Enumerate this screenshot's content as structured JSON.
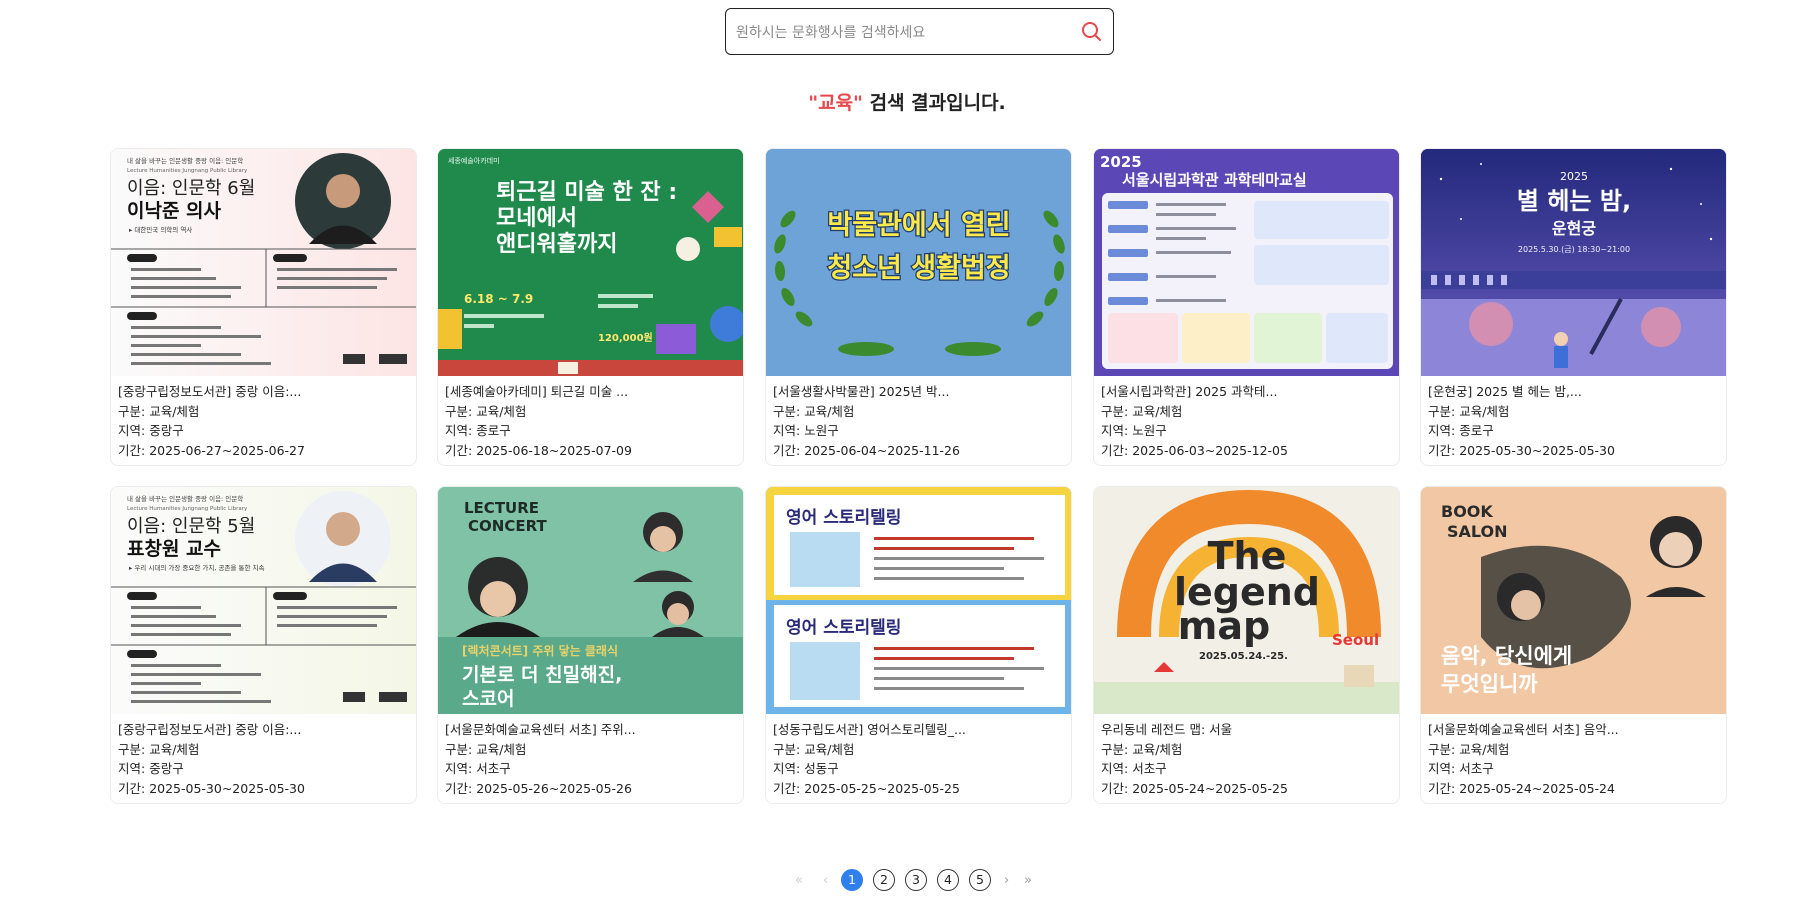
{
  "search": {
    "placeholder": "원하시는 문화행사를 검색하세요"
  },
  "result": {
    "keyword": "\"교육\"",
    "suffix": " 검색 결과입니다."
  },
  "labels": {
    "category": "구분: ",
    "region": "지역: ",
    "period": "기간: "
  },
  "cards": [
    {
      "title": "[중랑구립정보도서관] 중랑 이음:...",
      "category": "교육/체험",
      "region": "중랑구",
      "period": "2025-06-27~2025-06-27",
      "poster": {
        "top": "내 삶을 바꾸는 인문생활  중랑 이음: 인문학",
        "sub": "Lecture Humanities  Jungnang Public Library",
        "headline": "이음: 인문학 6월",
        "name": "이낙준 의사",
        "desc": "▸ 대한민국 의학의 역사"
      }
    },
    {
      "title": "[세종예술아카데미] 퇴근길 미술 ...",
      "category": "교육/체험",
      "region": "종로구",
      "period": "2025-06-18~2025-07-09",
      "poster": {
        "tag": "세종예술아카데미",
        "line1": "퇴근길 미술 한 잔 :",
        "line2": "모네에서",
        "line3": "앤디워홀까지",
        "date": "6.18 ~ 7.9",
        "fee": "120,000원"
      }
    },
    {
      "title": "[서울생활사박물관] 2025년 박...",
      "category": "교육/체험",
      "region": "노원구",
      "period": "2025-06-04~2025-11-26",
      "poster": {
        "line1": "박물관에서 열린",
        "line2": "청소년 생활법정"
      }
    },
    {
      "title": "[서울시립과학관] 2025 과학테...",
      "category": "교육/체험",
      "region": "노원구",
      "period": "2025-06-03~2025-12-05",
      "poster": {
        "year": "2025",
        "line1": "서울시립과학관 과학테마교실"
      }
    },
    {
      "title": "[운현궁] 2025 별 헤는 밤,...",
      "category": "교육/체험",
      "region": "종로구",
      "period": "2025-05-30~2025-05-30",
      "poster": {
        "year": "2025",
        "line1": "별 헤는 밤,",
        "line2": "운현궁",
        "date": "2025.5.30.(금) 18:30~21:00"
      }
    },
    {
      "title": "[중랑구립정보도서관] 중랑 이음:...",
      "category": "교육/체험",
      "region": "중랑구",
      "period": "2025-05-30~2025-05-30",
      "poster": {
        "top": "내 삶을 바꾸는 인문생활  중랑 이음: 인문학",
        "sub": "Lecture Humanities  Jungnang Public Library",
        "headline": "이음: 인문학 5월",
        "name": "표창원 교수",
        "desc": "▸ 우리 시대의 가장 중요한 가치, 공존을 통한 치속"
      }
    },
    {
      "title": "[서울문화예술교육센터 서초] 주위...",
      "category": "교육/체험",
      "region": "서초구",
      "period": "2025-05-26~2025-05-26",
      "poster": {
        "tag1": "LECTURE",
        "tag2": "CONCERT",
        "line1": "[렉처콘서트] 주위 닿는 클래식",
        "line2": "기본로 더 친밀해진,",
        "line3": "스코어"
      }
    },
    {
      "title": "[성동구립도서관] 영어스토리텔링_...",
      "category": "교육/체험",
      "region": "성동구",
      "period": "2025-05-25~2025-05-25",
      "poster": {
        "line1": "영어 스토리텔링",
        "line2": "영어 스토리텔링"
      }
    },
    {
      "title": "우리동네 레전드 맵: 서울",
      "category": "교육/체험",
      "region": "서초구",
      "period": "2025-05-24~2025-05-25",
      "poster": {
        "line1": "The",
        "line2": "legend",
        "line3": "map",
        "city": "Seoul",
        "date": "2025.05.24.-25."
      }
    },
    {
      "title": "[서울문화예술교육센터 서초] 음악...",
      "category": "교육/체험",
      "region": "서초구",
      "period": "2025-05-24~2025-05-24",
      "poster": {
        "tag1": "BOOK",
        "tag2": "SALON",
        "line1": "음악, 당신에게",
        "line2": "무엇입니까"
      }
    }
  ],
  "pagination": {
    "first": "«",
    "prev": "‹",
    "next": "›",
    "last": "»",
    "pages": [
      "1",
      "2",
      "3",
      "4",
      "5"
    ],
    "current": "1"
  }
}
